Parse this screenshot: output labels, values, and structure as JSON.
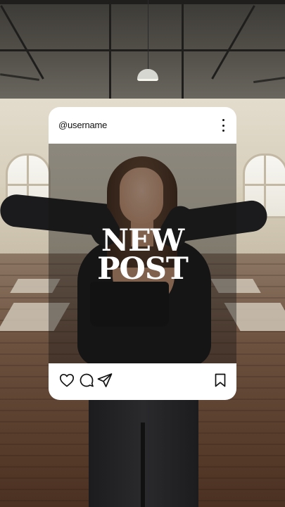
{
  "post": {
    "username": "@username",
    "headline_line1": "NEW",
    "headline_line2": "POST"
  },
  "icons": {
    "more": "more-vertical-icon",
    "like": "heart-icon",
    "comment": "comment-icon",
    "share": "send-icon",
    "save": "bookmark-icon"
  },
  "colors": {
    "card_background": "#ffffff",
    "text": "#111111",
    "headline": "#ffffff"
  }
}
